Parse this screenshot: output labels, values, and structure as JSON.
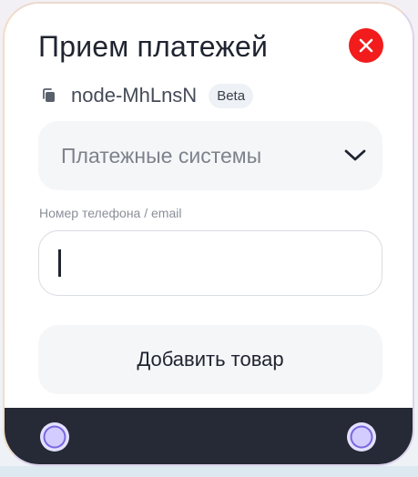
{
  "node": {
    "title": "Прием платежей",
    "id": "node-MhLnsN",
    "badge": "Beta"
  },
  "select": {
    "value": "Платежные системы"
  },
  "contact_field": {
    "label": "Номер телефона / email",
    "value": "",
    "placeholder": ""
  },
  "add_button": {
    "label": "Добавить товар"
  },
  "icons": {
    "close": "close-icon",
    "copy": "copy-icon",
    "chevron": "chevron-down-icon",
    "handles": [
      "connection-handle-icon",
      "connection-handle-icon"
    ]
  },
  "colors": {
    "close_button": "#f21c1c",
    "footer": "#252a36",
    "handle_fill": "#cfc8ff",
    "field_background": "#f5f6f8"
  }
}
